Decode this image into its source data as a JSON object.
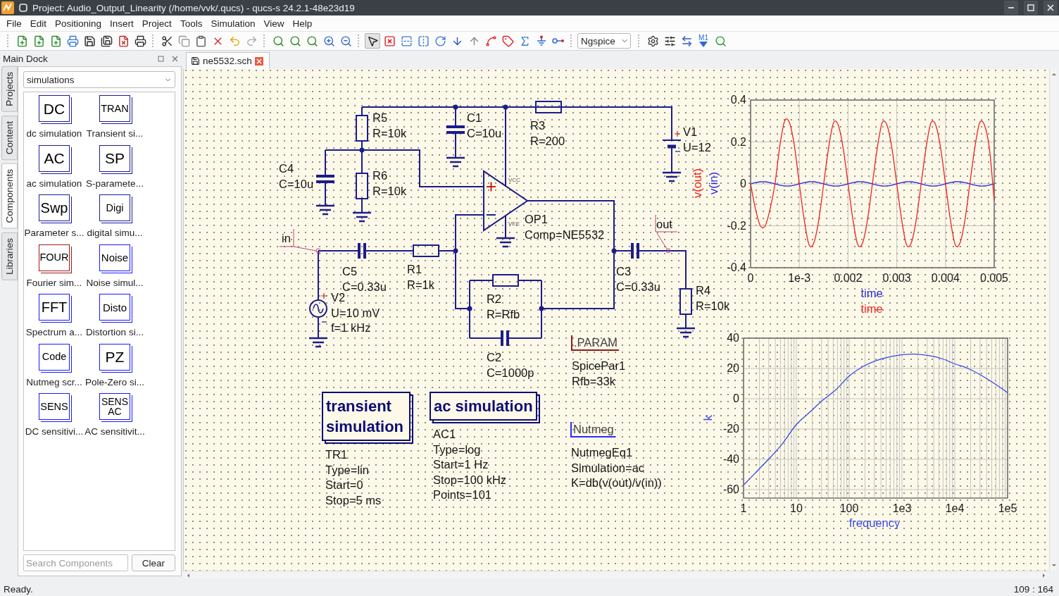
{
  "window": {
    "title": "Project: Audio_Output_Linearity (/home/vvk/.qucs) - qucs-s 24.2.1-48e23d19"
  },
  "menu": [
    "File",
    "Edit",
    "Positioning",
    "Insert",
    "Project",
    "Tools",
    "Simulation",
    "View",
    "Help"
  ],
  "toolbar": [
    {
      "kind": "group",
      "buttons": [
        {
          "kind": "new",
          "selected": false
        },
        {
          "kind": "new-text",
          "selected": false
        },
        {
          "kind": "new-symbol",
          "selected": false
        },
        {
          "kind": "open",
          "selected": false
        },
        {
          "kind": "save",
          "selected": false
        },
        {
          "kind": "save-all",
          "selected": false
        },
        {
          "kind": "close",
          "selected": false
        },
        {
          "kind": "print",
          "selected": false
        }
      ]
    },
    {
      "kind": "group",
      "buttons": [
        {
          "kind": "cut",
          "selected": false
        },
        {
          "kind": "copy",
          "selected": false
        },
        {
          "kind": "paste",
          "selected": false
        },
        {
          "kind": "delete",
          "selected": false
        },
        {
          "kind": "undo",
          "selected": false
        },
        {
          "kind": "redo",
          "selected": false
        }
      ]
    },
    {
      "kind": "group",
      "buttons": [
        {
          "kind": "zoom-fit",
          "selected": false
        },
        {
          "kind": "zoom-select",
          "selected": false
        },
        {
          "kind": "zoom-one",
          "selected": false
        },
        {
          "kind": "zoom-in",
          "selected": false
        },
        {
          "kind": "zoom-out",
          "selected": false
        }
      ]
    },
    {
      "kind": "group",
      "buttons": [
        {
          "kind": "select",
          "selected": true
        },
        {
          "kind": "deactivate",
          "selected": false
        },
        {
          "kind": "mirror-x",
          "selected": false
        },
        {
          "kind": "mirror-y",
          "selected": false
        },
        {
          "kind": "rotate",
          "selected": false
        },
        {
          "kind": "enter",
          "selected": false
        },
        {
          "kind": "leave",
          "selected": false
        },
        {
          "kind": "wire",
          "selected": false
        },
        {
          "kind": "label",
          "selected": false
        },
        {
          "kind": "equation",
          "selected": false
        },
        {
          "kind": "ground",
          "selected": false
        },
        {
          "kind": "port",
          "selected": false
        }
      ]
    },
    {
      "kind": "select",
      "value": "Ngspice"
    },
    {
      "kind": "group",
      "buttons": [
        {
          "kind": "simulate",
          "selected": false
        },
        {
          "kind": "display",
          "selected": false
        },
        {
          "kind": "switch",
          "selected": false
        },
        {
          "kind": "marker",
          "text": "M1",
          "selected": false
        },
        {
          "kind": "tune",
          "selected": false
        }
      ]
    }
  ],
  "dock": {
    "title": "Main Dock",
    "tabs": [
      {
        "label": "Projects",
        "selected": false
      },
      {
        "label": "Content",
        "selected": false
      },
      {
        "label": "Components",
        "selected": true
      },
      {
        "label": "Libraries",
        "selected": false
      }
    ],
    "category": "simulations",
    "items": [
      {
        "icon": "DC",
        "caption": "dc simulation",
        "color": "#1c1c9c"
      },
      {
        "icon": "TRAN",
        "caption": "Transient si...",
        "color": "#1c1c9c"
      },
      {
        "icon": "AC",
        "caption": "ac simulation",
        "color": "#1c1c9c"
      },
      {
        "icon": "SP",
        "caption": "S-paramete...",
        "color": "#1c1c9c"
      },
      {
        "icon": "Swp",
        "caption": "Parameter s...",
        "color": "#1c1c9c"
      },
      {
        "icon": "Digi",
        "caption": "digital simu...",
        "color": "#1c1c9c"
      },
      {
        "icon": "FOUR",
        "caption": "Fourier sim...",
        "color": "#a01818"
      },
      {
        "icon": "Noise",
        "caption": "Noise simul...",
        "color": "#1a1aff"
      },
      {
        "icon": "FFT",
        "caption": "Spectrum a...",
        "color": "#1a1aff"
      },
      {
        "icon": "Disto",
        "caption": "Distortion si...",
        "color": "#1a1aff"
      },
      {
        "icon": "Code",
        "caption": "Nutmeg scr...",
        "color": "#1a1aff"
      },
      {
        "icon": "PZ",
        "caption": "Pole-Zero si...",
        "color": "#1a1aff"
      },
      {
        "icon": "SENS",
        "caption": "DC sensitivi...",
        "color": "#1a1aff"
      },
      {
        "icon": "SENS AC",
        "caption": "AC sensitivit...",
        "color": "#1a1aff"
      }
    ],
    "search": {
      "placeholder": "Search Components"
    },
    "clear_button": "Clear"
  },
  "editor": {
    "tabs": [
      {
        "label": "ne5532.sch",
        "selected": true
      }
    ]
  },
  "schematic": {
    "components": [
      {
        "kind": "resistor",
        "lines": [
          "R5",
          "R=10k"
        ]
      },
      {
        "kind": "capacitor",
        "lines": [
          "C1",
          "C=10u"
        ]
      },
      {
        "kind": "resistor",
        "lines": [
          "R3",
          "R=200"
        ]
      },
      {
        "kind": "dc_source",
        "lines": [
          "V1",
          "U=12"
        ]
      },
      {
        "kind": "capacitor",
        "lines": [
          "C4",
          "C=10u"
        ]
      },
      {
        "kind": "resistor",
        "lines": [
          "R6",
          "R=10k"
        ]
      },
      {
        "kind": "opamp",
        "lines": [
          "OP1",
          "Comp=NE5532"
        ],
        "pins": [
          "VCC",
          "VEE"
        ]
      },
      {
        "kind": "capacitor",
        "lines": [
          "C5",
          "C=0.33u"
        ]
      },
      {
        "kind": "resistor",
        "lines": [
          "R1",
          "R=1k"
        ]
      },
      {
        "kind": "capacitor",
        "lines": [
          "C3",
          "C=0.33u"
        ]
      },
      {
        "kind": "resistor",
        "lines": [
          "R2",
          "R=Rfb"
        ]
      },
      {
        "kind": "resistor",
        "lines": [
          "R4",
          "R=10k"
        ]
      },
      {
        "kind": "ac_source",
        "lines": [
          "V2",
          "U=10 mV",
          "f=1 kHz"
        ]
      },
      {
        "kind": "capacitor",
        "lines": [
          "C2",
          "C=1000p"
        ]
      }
    ],
    "net_labels": [
      {
        "text": "in"
      },
      {
        "text": "out"
      }
    ],
    "directives": [
      {
        "kind": "param",
        "title": ".PARAM",
        "lines": [
          "SpicePar1",
          "Rfb=33k"
        ]
      },
      {
        "kind": "nutmeg",
        "title": "Nutmeg",
        "lines": [
          "NutmegEq1",
          "Simulation=ac",
          "K=db(v(out)/v(in))"
        ]
      }
    ],
    "simulations": [
      {
        "title": "transient simulation",
        "lines": [
          "TR1",
          "Type=lin",
          "Start=0",
          "Stop=5 ms"
        ]
      },
      {
        "title": "ac simulation",
        "lines": [
          "AC1",
          "Type=log",
          "Start=1 Hz",
          "Stop=100 kHz",
          "Points=101"
        ]
      }
    ],
    "plots": [
      {
        "chart_data": {
          "type": "line",
          "xlabel": "time",
          "grid": true,
          "xlim": [
            0,
            0.005
          ],
          "ylim": [
            -0.4,
            0.4
          ],
          "xticks": [
            0,
            {
              "value": 0.001,
              "label": "1e-3"
            },
            0.002,
            0.003,
            0.004,
            0.005
          ],
          "yticks": [
            -0.4,
            -0.2,
            0,
            0.2,
            0.4
          ],
          "x": [
            0,
            0.0001,
            0.0002,
            0.0003,
            0.0004,
            0.0005,
            0.0006,
            0.0007,
            0.0008,
            0.0009,
            0.001,
            0.0011,
            0.0012,
            0.0013,
            0.0014,
            0.0015,
            0.0016,
            0.0017,
            0.0018,
            0.0019,
            0.002,
            0.0021,
            0.0022,
            0.0023,
            0.0024,
            0.0025,
            0.0026,
            0.0027,
            0.0028,
            0.0029,
            0.003,
            0.0031,
            0.0032,
            0.0033,
            0.0034,
            0.0035,
            0.0036,
            0.0037,
            0.0038,
            0.0039,
            0.004,
            0.0041,
            0.0042,
            0.0043,
            0.0044,
            0.0045,
            0.0046,
            0.0047,
            0.0048,
            0.0049,
            0.005
          ],
          "series": [
            {
              "name": "v(in)",
              "color": "#2a2ae0",
              "values": [
                0,
                0.006,
                0.01,
                0.01,
                0.006,
                0,
                -0.006,
                -0.01,
                -0.01,
                -0.006,
                0,
                0.006,
                0.01,
                0.01,
                0.006,
                0,
                -0.006,
                -0.01,
                -0.01,
                -0.006,
                0,
                0.006,
                0.01,
                0.01,
                0.006,
                0,
                -0.006,
                -0.01,
                -0.01,
                -0.006,
                0,
                0.006,
                0.01,
                0.01,
                0.006,
                0,
                -0.006,
                -0.01,
                -0.01,
                -0.006,
                0,
                0.006,
                0.01,
                0.01,
                0.006,
                0,
                -0.006,
                -0.01,
                -0.01,
                -0.006,
                0
              ]
            },
            {
              "name": "v(out)",
              "color": "#ee2222",
              "values": [
                0,
                -0.12,
                -0.2,
                -0.2,
                -0.12,
                0,
                0.18,
                0.3,
                0.29,
                0.18,
                0,
                -0.17,
                -0.29,
                -0.28,
                -0.17,
                0,
                0.17,
                0.29,
                0.28,
                0.17,
                0,
                -0.17,
                -0.29,
                -0.28,
                -0.17,
                0,
                0.17,
                0.29,
                0.28,
                0.17,
                0,
                -0.17,
                -0.29,
                -0.28,
                -0.17,
                0,
                0.17,
                0.29,
                0.28,
                0.17,
                0,
                -0.17,
                -0.29,
                -0.28,
                -0.17,
                0,
                0.17,
                0.29,
                0.28,
                0.17,
                -0.08
              ]
            }
          ],
          "annotations": [
            {
              "text": "time"
            }
          ]
        }
      },
      {
        "chart_data": {
          "type": "line",
          "xlabel": "frequency",
          "grid": true,
          "ylim": [
            -65.6,
            40
          ],
          "categories": [
            "1",
            null,
            null,
            null,
            "10",
            null,
            null,
            null,
            "100",
            null,
            null,
            null,
            "1e3",
            null,
            null,
            null,
            "1e4",
            null,
            null,
            null,
            "1e5"
          ],
          "yticks": [
            -60,
            -40,
            -20,
            0,
            20,
            40
          ],
          "series": [
            {
              "name": "k",
              "color": "#3a48e8",
              "values": [
                -57,
                -48,
                -39,
                -29,
                -17,
                -9,
                -1,
                6,
                15,
                21,
                25,
                27.5,
                29,
                29.5,
                28.5,
                26.5,
                23,
                20,
                15.5,
                10,
                4
              ]
            }
          ]
        }
      }
    ]
  },
  "status_bar": {
    "message": "Ready.",
    "position": "109 : 164"
  }
}
